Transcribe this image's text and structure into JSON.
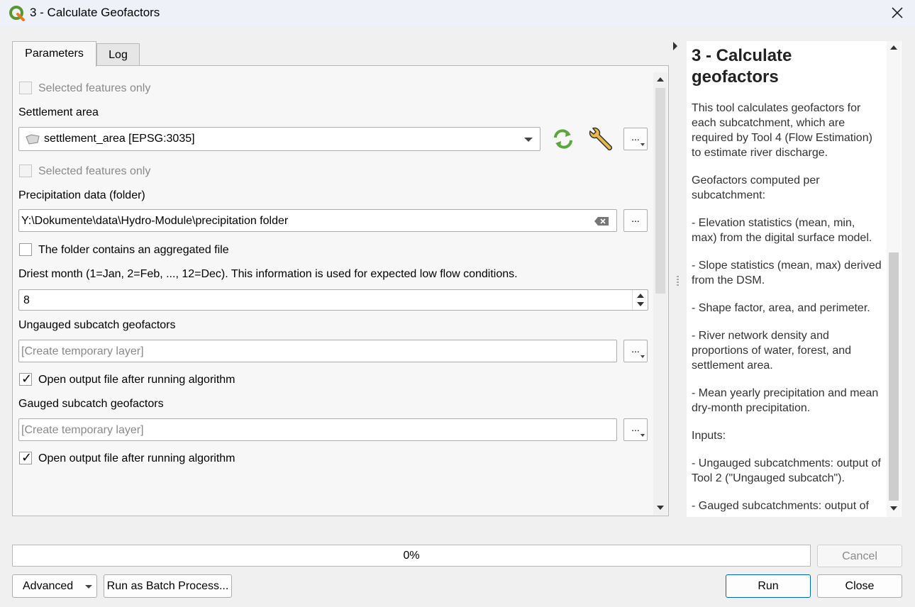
{
  "window": {
    "title": "3 - Calculate Geofactors",
    "icon": "qgis-logo-icon",
    "close_icon": "close-icon"
  },
  "tabs": [
    {
      "label": "Parameters",
      "active": true
    },
    {
      "label": "Log",
      "active": false
    }
  ],
  "params": {
    "selected_features_1": {
      "label": "Selected features only",
      "checked": false,
      "enabled": false
    },
    "settlement": {
      "label": "Settlement area",
      "value": "settlement_area [EPSG:3035]",
      "layer_icon": "polygon-layer-icon",
      "iterate_icon": "iterate-icon",
      "settings_icon": "wrench-icon",
      "more_label": "..."
    },
    "selected_features_2": {
      "label": "Selected features only",
      "checked": false,
      "enabled": false
    },
    "precip": {
      "label": "Precipitation data (folder)",
      "value": "Y:\\Dokumente\\data\\Hydro-Module\\precipitation folder",
      "clear_icon": "clear-icon",
      "more_label": "..."
    },
    "aggregated": {
      "label": "The folder contains an aggregated file",
      "checked": false
    },
    "driest": {
      "label": "Driest month (1=Jan, 2=Feb, ..., 12=Dec). This information is used for expected low flow conditions.",
      "value": "8"
    },
    "ungauged": {
      "label": "Ungauged subcatch geofactors",
      "placeholder": "[Create temporary layer]",
      "more_label": "...",
      "open_after": {
        "label": "Open output file after running algorithm",
        "checked": true
      }
    },
    "gauged": {
      "label": "Gauged subcatch geofactors",
      "placeholder": "[Create temporary layer]",
      "more_label": "...",
      "open_after": {
        "label": "Open output file after running algorithm",
        "checked": true
      }
    },
    "check_mark": "✓"
  },
  "help": {
    "title": "3 - Calculate geofactors",
    "paragraphs": [
      "This tool calculates geofactors for each subcatchment, which are required by Tool 4 (Flow Estimation) to estimate river discharge.",
      "Geofactors computed per subcatchment:",
      "- Elevation statistics (mean, min, max) from the digital surface model.",
      "- Slope statistics (mean, max) derived from the DSM.",
      "- Shape factor, area, and perimeter.",
      "- River network density and proportions of water, forest, and settlement area.",
      "- Mean yearly precipitation and mean dry-month precipitation.",
      "Inputs:",
      "- Ungauged subcatchments: output of Tool 2 (\"Ungauged subcatch\").",
      "- Gauged subcatchments: output of"
    ]
  },
  "progress": {
    "label": "0%",
    "value": 0
  },
  "buttons": {
    "cancel": "Cancel",
    "advanced": "Advanced",
    "batch": "Run as Batch Process...",
    "run": "Run",
    "close": "Close"
  },
  "colors": {
    "accent": "#0067c0",
    "iterate_green": "#5aa83a",
    "qgis_green": "#589632"
  }
}
